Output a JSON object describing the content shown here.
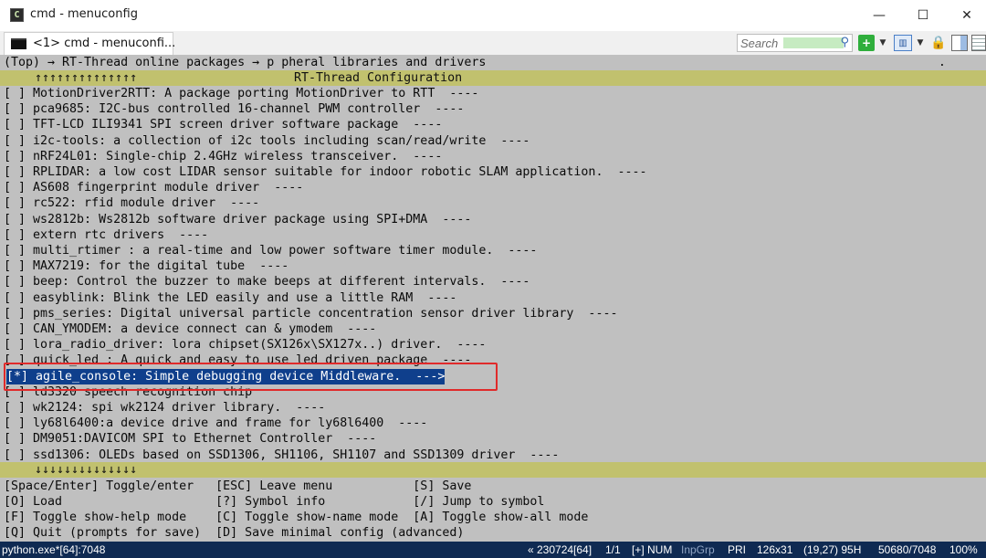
{
  "window": {
    "title": "cmd - menuconfig",
    "app_icon": "console-app-icon",
    "controls": {
      "minimize": "—",
      "maximize": "☐",
      "close": "✕"
    }
  },
  "tabbar": {
    "tab_label": "<1> cmd - menuconfi...",
    "search_placeholder": "Search",
    "buttons": [
      "add-tab-icon",
      "dropdown-icon",
      "view-icon",
      "dropdown-icon",
      "lock-icon",
      "panel-icon",
      "menu-icon"
    ]
  },
  "terminal": {
    "breadcrumb": "(Top) → RT-Thread online packages → p pheral libraries and drivers",
    "header_arrows": "↑↑↑↑↑↑↑↑↑↑↑↑↑↑",
    "header_title": "RT-Thread Configuration",
    "items": [
      "[ ] MotionDriver2RTT: A package porting MotionDriver to RTT  ----",
      "[ ] pca9685: I2C-bus controlled 16-channel PWM controller  ----",
      "[ ] TFT-LCD ILI9341 SPI screen driver software package  ----",
      "[ ] i2c-tools: a collection of i2c tools including scan/read/write  ----",
      "[ ] nRF24L01: Single-chip 2.4GHz wireless transceiver.  ----",
      "[ ] RPLIDAR: a low cost LIDAR sensor suitable for indoor robotic SLAM application.  ----",
      "[ ] AS608 fingerprint module driver  ----",
      "[ ] rc522: rfid module driver  ----",
      "[ ] ws2812b: Ws2812b software driver package using SPI+DMA  ----",
      "[ ] extern rtc drivers  ----",
      "[ ] multi_rtimer : a real-time and low power software timer module.  ----",
      "[ ] MAX7219: for the digital tube  ----",
      "[ ] beep: Control the buzzer to make beeps at different intervals.  ----",
      "[ ] easyblink: Blink the LED easily and use a little RAM  ----",
      "[ ] pms_series: Digital universal particle concentration sensor driver library  ----",
      "[ ] CAN_YMODEM: a device connect can & ymodem  ----",
      "[ ] lora_radio_driver: lora chipset(SX126x\\SX127x..) driver.  ----",
      "[ ] quick_led : A quick and easy to use led driven package  ----",
      "[*] agile_console: Simple debugging device Middleware.  --->",
      "[ ] ld3320 speech recognition chip",
      "[ ] wk2124: spi wk2124 driver library.  ----",
      "[ ] ly68l6400:a device drive and frame for ly68l6400  ----",
      "[ ] DM9051:DAVICOM SPI to Ethernet Controller  ----",
      "[ ] ssd1306: OLEDs based on SSD1306, SH1106, SH1107 and SSD1309 driver  ----"
    ],
    "selected_index": 18,
    "footer_arrows": "↓↓↓↓↓↓↓↓↓↓↓↓↓↓",
    "help": [
      "[Space/Enter] Toggle/enter   [ESC] Leave menu           [S] Save",
      "[O] Load                     [?] Symbol info            [/] Jump to symbol",
      "[F] Toggle show-help mode    [C] Toggle show-name mode  [A] Toggle show-all mode",
      "[Q] Quit (prompts for save)  [D] Save minimal config (advanced)"
    ],
    "scroll_marker": "."
  },
  "statusbar": {
    "process": "python.exe*[64]:7048",
    "build": "« 230724[64]",
    "page": "1/1",
    "flags": "[+] NUM",
    "inpgrp": "InpGrp",
    "pri": "PRI",
    "size": "126x31",
    "cursor": "(19,27) 95H",
    "pid": "50680/7048",
    "zoom": "100%"
  },
  "colors": {
    "terminal_bg": "#c0c0c0",
    "bar_bg": "#c1c16e",
    "selection_bg": "#0f3f8c",
    "highlight_box": "#e02a2a",
    "statusbar_bg": "#0f2a52"
  }
}
